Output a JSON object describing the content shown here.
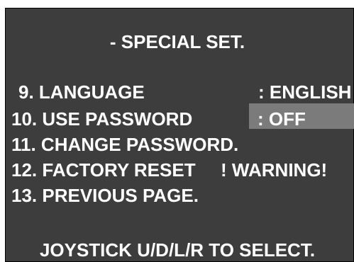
{
  "title": "- SPECIAL SET.",
  "menu": {
    "items": [
      {
        "label": "9. LANGUAGE",
        "value": ": ENGLISH"
      },
      {
        "label": "10. USE PASSWORD",
        "value": ": OFF"
      },
      {
        "label": "11. CHANGE PASSWORD."
      },
      {
        "label": "12. FACTORY RESET",
        "note": "! WARNING!"
      },
      {
        "label": "13. PREVIOUS PAGE."
      }
    ]
  },
  "footer": "JOYSTICK U/D/L/R TO SELECT.",
  "colors": {
    "panel_background": "#3d3d3d",
    "highlight_background": "#7b7b7b",
    "text": "#ffffff"
  }
}
